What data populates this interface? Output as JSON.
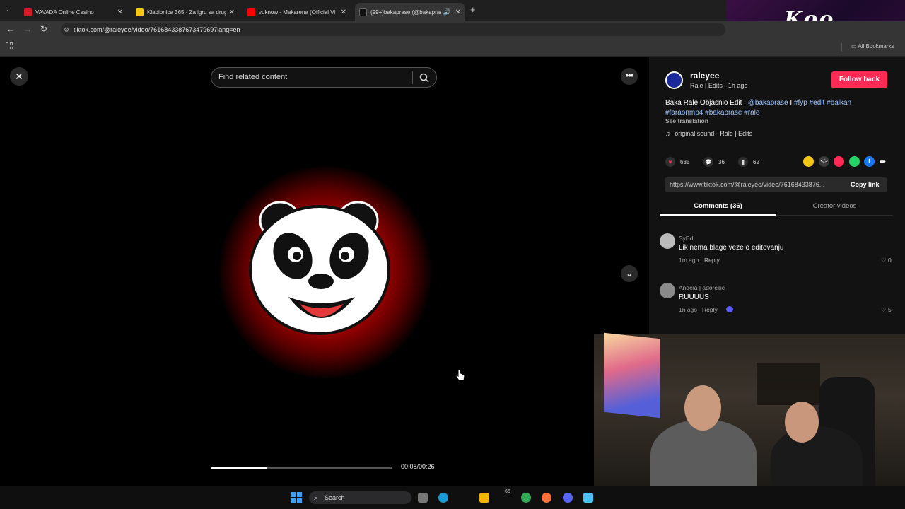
{
  "browser": {
    "tabs": [
      {
        "title": "VAVADA Online Casino",
        "color": "#d11a2a"
      },
      {
        "title": "Kladionica 365 - Za igru sa druge",
        "color": "#f5c518"
      },
      {
        "title": "vuknow - Makarena (Official Vi",
        "color": "#ff0000"
      },
      {
        "title": "(99+)bakaprase (@bakapras",
        "color": "#111111"
      }
    ],
    "new_tab": "+",
    "url": "tiktok.com/@raleyee/video/7616843387673479697lang=en",
    "all_bookmarks": "All Bookmarks"
  },
  "stream_overlay": {
    "logo_text": "Koo"
  },
  "player": {
    "search_placeholder": "Find related content",
    "progress": 0.31,
    "time": "00:08/00:26"
  },
  "author": {
    "username": "raleyee",
    "subline": "Rale | Edits · 1h ago",
    "follow_label": "Follow back"
  },
  "description": {
    "text_plain": "Baka Rale Objasnio Edit I",
    "tag_mention": "@bakaprase",
    "sep": "I",
    "tags_line1": "#fyp #edit #balkan",
    "tags_line2": "#faraonmp4 #bakaprase #rale",
    "see_translation": "See translation",
    "sound": "original sound - Rale | Edits"
  },
  "stats": {
    "likes": "635",
    "comments": "36",
    "saves": "62"
  },
  "link": {
    "url": "https://www.tiktok.com/@raleyee/video/76168433876...",
    "copy_label": "Copy link"
  },
  "tabs": {
    "comments": "Comments (36)",
    "creator": "Creator videos"
  },
  "comments": [
    {
      "user": "SyEd",
      "text": "Lik nema blage veze o editovanju",
      "time": "1m ago",
      "reply": "Reply",
      "likes": "0"
    },
    {
      "user": "Anđela | adoreilic",
      "text": "RUUUUS",
      "time": "1h ago",
      "reply": "Reply",
      "likes": "5"
    }
  ],
  "taskbar": {
    "search": "Search",
    "badge": "65"
  },
  "colors": {
    "accent": "#fe2c55",
    "link": "#9ec5ff"
  }
}
